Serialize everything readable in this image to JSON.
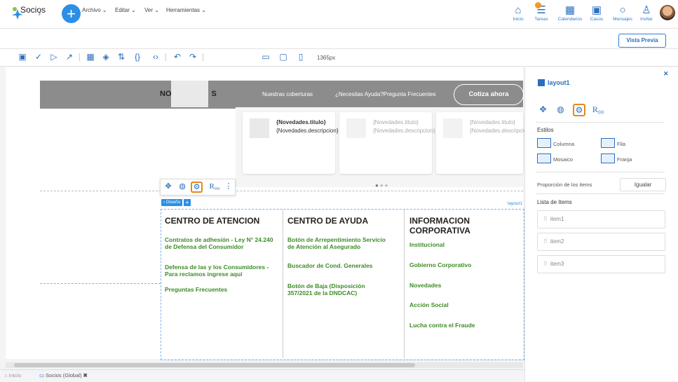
{
  "topnav": [
    {
      "label": "Inicio",
      "icon": "home-icon"
    },
    {
      "label": "Tareas",
      "icon": "tasks-icon"
    },
    {
      "label": "Calendarios",
      "icon": "calendar-icon"
    },
    {
      "label": "Casos",
      "icon": "briefcase-icon"
    },
    {
      "label": "Mensajes",
      "icon": "chat-icon"
    },
    {
      "label": "Invitar",
      "icon": "add-user-icon"
    }
  ],
  "app": {
    "name": "Socios"
  },
  "menus": [
    "Archivo",
    "Editar",
    "Ver",
    "Herramientas"
  ],
  "preview_button": "Vista Previa",
  "toolbar": {
    "width_label": "1365px"
  },
  "site": {
    "nav_title": "NO",
    "nav_title_end": "S",
    "links": [
      "Nuestras coberturas",
      "¿Necesitas Ayuda?Pregunta Frecuentes"
    ],
    "cta": "Cotiza ahora"
  },
  "cards": [
    {
      "title": "{Novedades.titulo}",
      "desc": "{Novedades.descripcion}"
    },
    {
      "title": "{Novedades.titulo}",
      "desc": "{Novedades.descripcion}"
    },
    {
      "title": "{Novedades.titulo}",
      "desc": "{Novedades.descripcion}"
    }
  ],
  "layout_chip": {
    "diseno": "‹ Diseño",
    "plus": "+",
    "name": "layout1"
  },
  "columns": [
    {
      "title": "CENTRO DE ATENCION",
      "links": [
        "Contratos de adhesión - Ley N° 24.240 de Defensa del Consumidor",
        "Defensa de las y los Consumidores - Para reclamos ingrese aquí",
        "Preguntas Frecuentes"
      ]
    },
    {
      "title": "CENTRO DE AYUDA",
      "links": [
        "Botón de Arrepentimiento Servicio de Atención al Asegurado",
        "Buscador de Cond. Generales",
        "Botón de Baja (Disposición 357/2021 de la DNDCAC)"
      ]
    },
    {
      "title": "INFORMACION CORPORATIVA",
      "links": [
        "Institucional",
        "Gobierno Corporativo",
        "Novedades",
        "Acción Social",
        "Lucha contra el Fraude"
      ]
    }
  ],
  "panel": {
    "title": "layout1",
    "icon_r": "R₀₀",
    "estilos_label": "Estilos",
    "estilos": [
      "Columna",
      "Fila",
      "Mosaico",
      "Franja"
    ],
    "proporcion_label": "Proporción de los items",
    "igualar": "Igualar",
    "lista_label": "Lista de Items",
    "items": [
      "item1",
      "item2",
      "item3"
    ]
  },
  "footer_tabs": [
    "Inicio",
    "Socios (Global)"
  ],
  "colors": {
    "accent": "#2b8fe6",
    "link_green": "#3d8c27",
    "selected": "#e08a1e",
    "header_gray": "#8c8c8c"
  }
}
